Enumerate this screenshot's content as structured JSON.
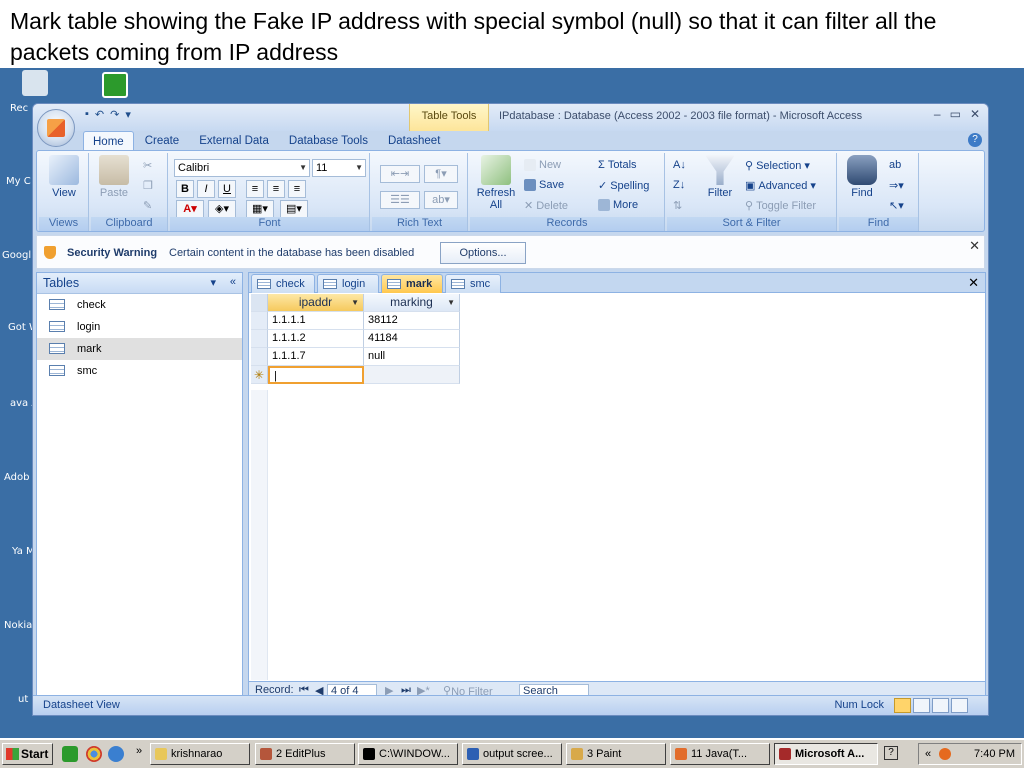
{
  "caption": "Mark table showing the Fake IP address with special symbol (null) so that it can filter all the packets coming from IP address",
  "desktop": {
    "labels": [
      "Rec",
      "My C",
      "Googl",
      "Got\nWith",
      "ava\nAn",
      "Adob",
      "Ya\nMes",
      "Nokia",
      "ut"
    ]
  },
  "window": {
    "contextual_tab": "Table Tools",
    "title": "IPdatabase : Database (Access 2002 - 2003 file format) - Microsoft Access",
    "minimize": "–",
    "maximize": "▭",
    "close": "✕"
  },
  "ribbon_tabs": [
    "Home",
    "Create",
    "External Data",
    "Database Tools",
    "Datasheet"
  ],
  "ribbon": {
    "views": {
      "label": "Views",
      "view": "View"
    },
    "clipboard": {
      "label": "Clipboard",
      "paste": "Paste"
    },
    "font": {
      "label": "Font",
      "face": "Calibri",
      "size": "11",
      "bold": "B",
      "italic": "I",
      "underline": "U"
    },
    "rich_text": {
      "label": "Rich Text"
    },
    "records": {
      "label": "Records",
      "refresh": "Refresh",
      "refresh_sub": "All",
      "new": "New",
      "save": "Save",
      "delete": "Delete",
      "totals": "Totals",
      "spelling": "Spelling",
      "more": "More"
    },
    "sort_filter": {
      "label": "Sort & Filter",
      "filter": "Filter",
      "selection": "Selection",
      "advanced": "Advanced",
      "toggle_filter": "Toggle Filter"
    },
    "find": {
      "label": "Find",
      "find": "Find"
    }
  },
  "security": {
    "title": "Security Warning",
    "message": "Certain content in the database has been disabled",
    "options": "Options..."
  },
  "nav": {
    "header": "Tables",
    "items": [
      "check",
      "login",
      "mark",
      "smc"
    ],
    "selected": "mark"
  },
  "doc_tabs": [
    "check",
    "login",
    "mark",
    "smc"
  ],
  "active_doc_tab": "mark",
  "datasheet": {
    "columns": [
      "ipaddr",
      "marking"
    ],
    "rows": [
      [
        "1.1.1.1",
        "38112"
      ],
      [
        "1.1.1.2",
        "41184"
      ],
      [
        "1.1.1.7",
        "null"
      ]
    ]
  },
  "record_nav": {
    "label": "Record:",
    "position": "4 of 4",
    "filter": "No Filter",
    "search": "Search"
  },
  "status": {
    "left": "Datasheet View",
    "num_lock": "Num Lock"
  },
  "taskbar": {
    "start": "Start",
    "items": [
      "krishnarao",
      "2 EditPlus",
      "C:\\WINDOW...",
      "output scree...",
      "3 Paint",
      "11 Java(T...",
      "Microsoft A..."
    ],
    "clock": "7:40 PM"
  }
}
